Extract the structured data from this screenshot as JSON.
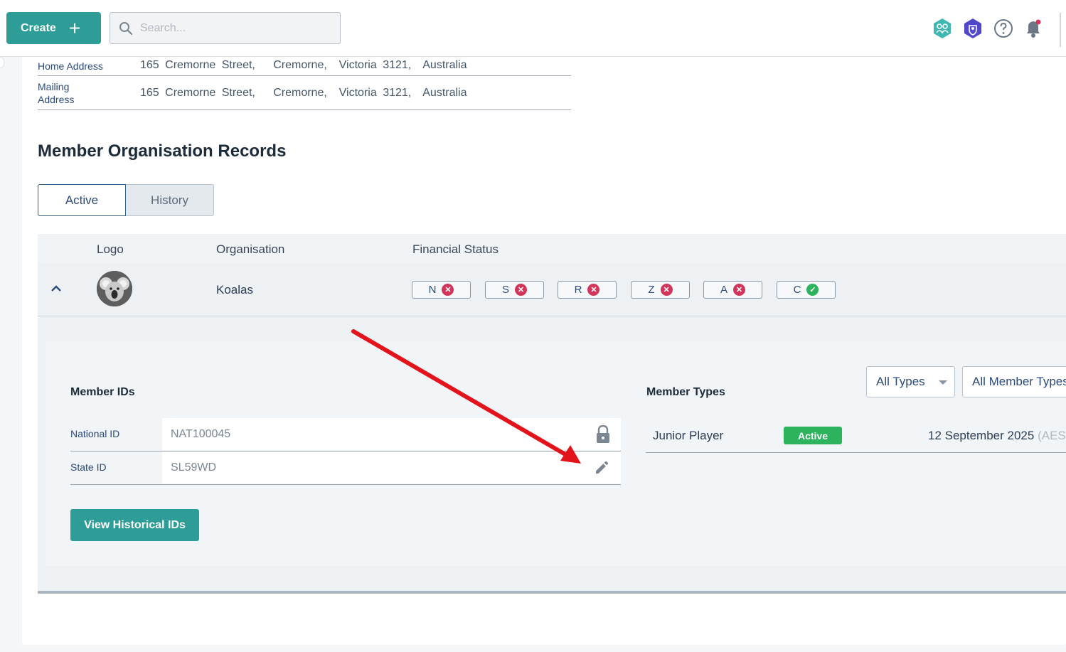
{
  "toolbar": {
    "create_label": "Create",
    "create_icon": "plus-icon",
    "search_placeholder": "Search...",
    "icons": [
      "members-hex-icon",
      "shield-hex-icon",
      "help-icon",
      "notification-bell-icon"
    ]
  },
  "addresses": [
    {
      "label": "Home Address",
      "street": "165 Cremorne Street,",
      "suburb": "Cremorne,",
      "state": "Victoria",
      "postcode": "3121,",
      "country": "Australia"
    },
    {
      "label": "Mailing Address",
      "street": "165 Cremorne Street,",
      "suburb": "Cremorne,",
      "state": "Victoria",
      "postcode": "3121,",
      "country": "Australia"
    }
  ],
  "section_title": "Member Organisation Records",
  "tabs": [
    {
      "label": "Active",
      "selected": true
    },
    {
      "label": "History",
      "selected": false
    }
  ],
  "table": {
    "headers": {
      "logo": "Logo",
      "organisation": "Organisation",
      "financial_status": "Financial Status"
    },
    "row": {
      "organisation": "Koalas",
      "statuses": [
        {
          "code": "N",
          "ok": false
        },
        {
          "code": "S",
          "ok": false
        },
        {
          "code": "R",
          "ok": false
        },
        {
          "code": "Z",
          "ok": false
        },
        {
          "code": "A",
          "ok": false
        },
        {
          "code": "C",
          "ok": true
        }
      ]
    }
  },
  "member_ids": {
    "title": "Member IDs",
    "rows": [
      {
        "label": "National ID",
        "value": "NAT100045",
        "icon": "lock-icon"
      },
      {
        "label": "State ID",
        "value": "SL59WD",
        "icon": "pencil-edit-icon"
      }
    ],
    "history_button": "View Historical IDs"
  },
  "member_types": {
    "title": "Member Types",
    "filter_type": "All Types",
    "filter_member_type": "All Member Types",
    "rows": [
      {
        "name": "Junior Player",
        "status": "Active",
        "date": "12 September 2025",
        "tz": "(AEST"
      }
    ]
  },
  "colors": {
    "accent_teal": "#2e9c97",
    "status_error": "#d1365a",
    "status_ok": "#2bb35e",
    "annotation_arrow": "#e3131b"
  }
}
